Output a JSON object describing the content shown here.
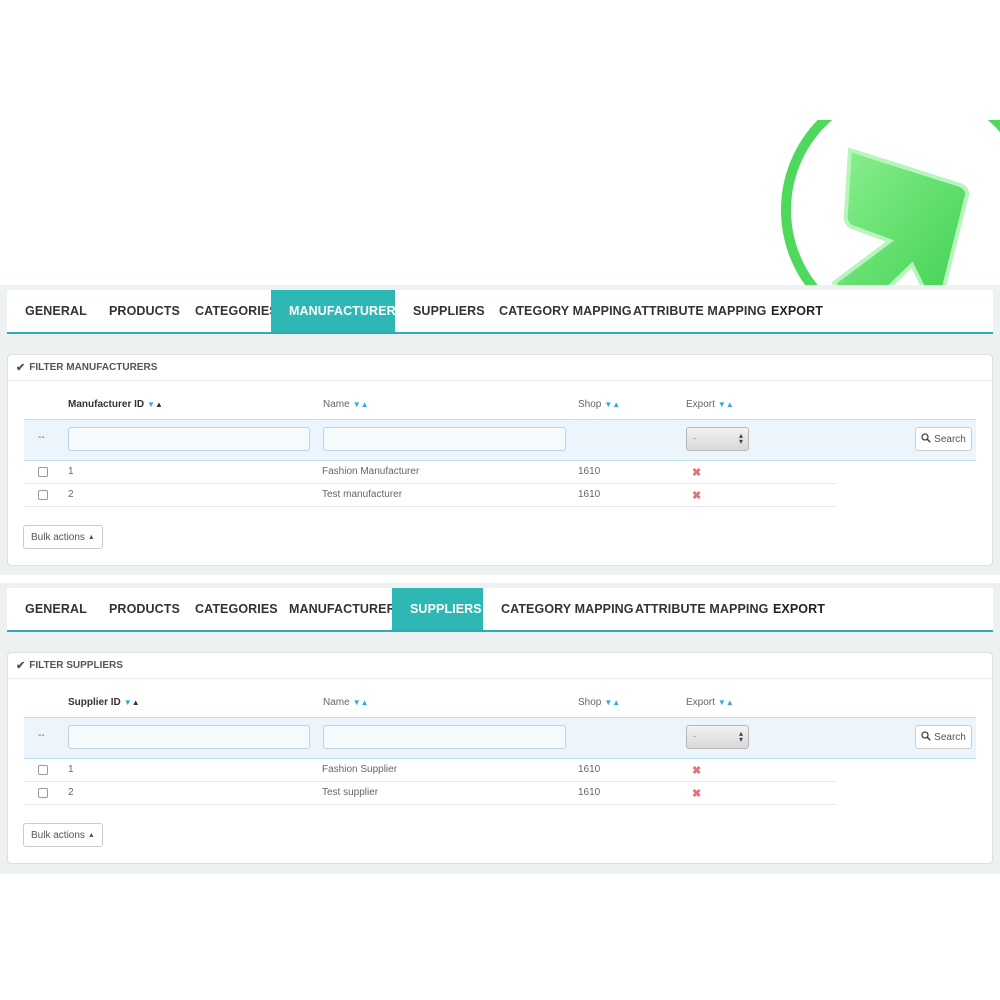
{
  "sections": [
    {
      "tabs": [
        {
          "label": "GENERAL",
          "active": false
        },
        {
          "label": "PRODUCTS",
          "active": false
        },
        {
          "label": "CATEGORIES",
          "active": false
        },
        {
          "label": "MANUFACTURERS",
          "active": true
        },
        {
          "label": "SUPPLIERS",
          "active": false
        },
        {
          "label": "CATEGORY MAPPING",
          "active": false
        },
        {
          "label": "ATTRIBUTE MAPPING",
          "active": false
        },
        {
          "label": "EXPORT",
          "active": false
        }
      ],
      "panel_title": "FILTER MANUFACTURERS",
      "columns": {
        "id": "Manufacturer ID",
        "name": "Name",
        "shop": "Shop",
        "export": "Export"
      },
      "filter": {
        "dashdash": "--",
        "select_value": "-",
        "search_label": "Search"
      },
      "rows": [
        {
          "id": "1",
          "name": "Fashion Manufacturer",
          "shop": "1610",
          "export": "✖"
        },
        {
          "id": "2",
          "name": "Test manufacturer",
          "shop": "1610",
          "export": "✖"
        }
      ],
      "bulk_label": "Bulk actions"
    },
    {
      "tabs": [
        {
          "label": "GENERAL",
          "active": false
        },
        {
          "label": "PRODUCTS",
          "active": false
        },
        {
          "label": "CATEGORIES",
          "active": false
        },
        {
          "label": "MANUFACTURERS",
          "active": false
        },
        {
          "label": "SUPPLIERS",
          "active": true
        },
        {
          "label": "CATEGORY MAPPING",
          "active": false
        },
        {
          "label": "ATTRIBUTE MAPPING",
          "active": false
        },
        {
          "label": "EXPORT",
          "active": false
        }
      ],
      "panel_title": "FILTER SUPPLIERS",
      "columns": {
        "id": "Supplier ID",
        "name": "Name",
        "shop": "Shop",
        "export": "Export"
      },
      "filter": {
        "dashdash": "--",
        "select_value": "-",
        "search_label": "Search"
      },
      "rows": [
        {
          "id": "1",
          "name": "Fashion Supplier",
          "shop": "1610",
          "export": "✖"
        },
        {
          "id": "2",
          "name": "Test supplier",
          "shop": "1610",
          "export": "✖"
        }
      ],
      "bulk_label": "Bulk actions"
    }
  ],
  "icons": {
    "logo": "green-arrow-logo-icon",
    "check": "check-icon",
    "sort_down": "sort-down-icon",
    "sort_up": "sort-up-icon",
    "search": "search-icon",
    "caret": "caret-up-icon",
    "delete": "cross-icon"
  },
  "colors": {
    "accent": "#2eb8b5",
    "tab_border": "#2eacb3",
    "logo_green": "#5ee06a",
    "cross": "#e0737b"
  }
}
